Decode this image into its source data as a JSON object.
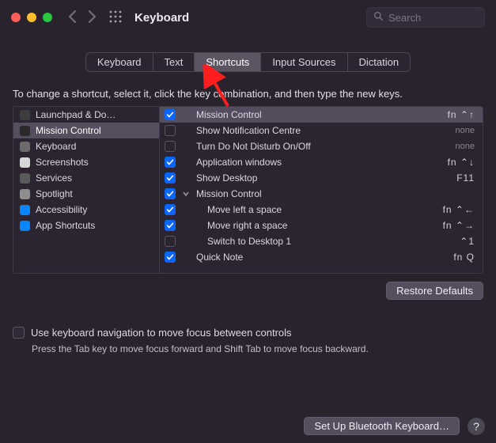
{
  "window": {
    "title": "Keyboard"
  },
  "search": {
    "placeholder": "Search"
  },
  "tabs": [
    {
      "label": "Keyboard",
      "active": false
    },
    {
      "label": "Text",
      "active": false
    },
    {
      "label": "Shortcuts",
      "active": true
    },
    {
      "label": "Input Sources",
      "active": false
    },
    {
      "label": "Dictation",
      "active": false
    }
  ],
  "instruction": "To change a shortcut, select it, click the key combination, and then type the new keys.",
  "sidebar": {
    "items": [
      {
        "label": "Launchpad & Do…",
        "icon_color": "#3d3d3d",
        "selected": false
      },
      {
        "label": "Mission Control",
        "icon_color": "#2a2a2a",
        "selected": true
      },
      {
        "label": "Keyboard",
        "icon_color": "#6b6b6b",
        "selected": false
      },
      {
        "label": "Screenshots",
        "icon_color": "#d7d7d7",
        "selected": false
      },
      {
        "label": "Services",
        "icon_color": "#5a5a5a",
        "selected": false
      },
      {
        "label": "Spotlight",
        "icon_color": "#8e8e8e",
        "selected": false
      },
      {
        "label": "Accessibility",
        "icon_color": "#0a84ff",
        "selected": false
      },
      {
        "label": "App Shortcuts",
        "icon_color": "#0a84ff",
        "selected": false
      }
    ]
  },
  "shortcuts": [
    {
      "checked": true,
      "label": "Mission Control",
      "shortcut": "fn ⌃↑",
      "selected": true,
      "indent": 0,
      "disclosure": null
    },
    {
      "checked": false,
      "label": "Show Notification Centre",
      "shortcut": "none",
      "selected": false,
      "indent": 0,
      "disclosure": null
    },
    {
      "checked": false,
      "label": "Turn Do Not Disturb On/Off",
      "shortcut": "none",
      "selected": false,
      "indent": 0,
      "disclosure": null
    },
    {
      "checked": true,
      "label": "Application windows",
      "shortcut": "fn ⌃↓",
      "selected": false,
      "indent": 0,
      "disclosure": null
    },
    {
      "checked": true,
      "label": "Show Desktop",
      "shortcut": "F11",
      "selected": false,
      "indent": 0,
      "disclosure": null
    },
    {
      "checked": true,
      "label": "Mission Control",
      "shortcut": "",
      "selected": false,
      "indent": 0,
      "disclosure": "open"
    },
    {
      "checked": true,
      "label": "Move left a space",
      "shortcut": "fn ⌃←",
      "selected": false,
      "indent": 1,
      "disclosure": null
    },
    {
      "checked": true,
      "label": "Move right a space",
      "shortcut": "fn ⌃→",
      "selected": false,
      "indent": 1,
      "disclosure": null
    },
    {
      "checked": false,
      "label": "Switch to Desktop 1",
      "shortcut": "⌃1",
      "selected": false,
      "indent": 1,
      "disclosure": null
    },
    {
      "checked": true,
      "label": "Quick Note",
      "shortcut": "fn Q",
      "selected": false,
      "indent": 0,
      "disclosure": null
    }
  ],
  "buttons": {
    "restore": "Restore Defaults",
    "bluetooth": "Set Up Bluetooth Keyboard…"
  },
  "keyboard_nav": {
    "label": "Use keyboard navigation to move focus between controls",
    "hint": "Press the Tab key to move focus forward and Shift Tab to move focus backward."
  }
}
